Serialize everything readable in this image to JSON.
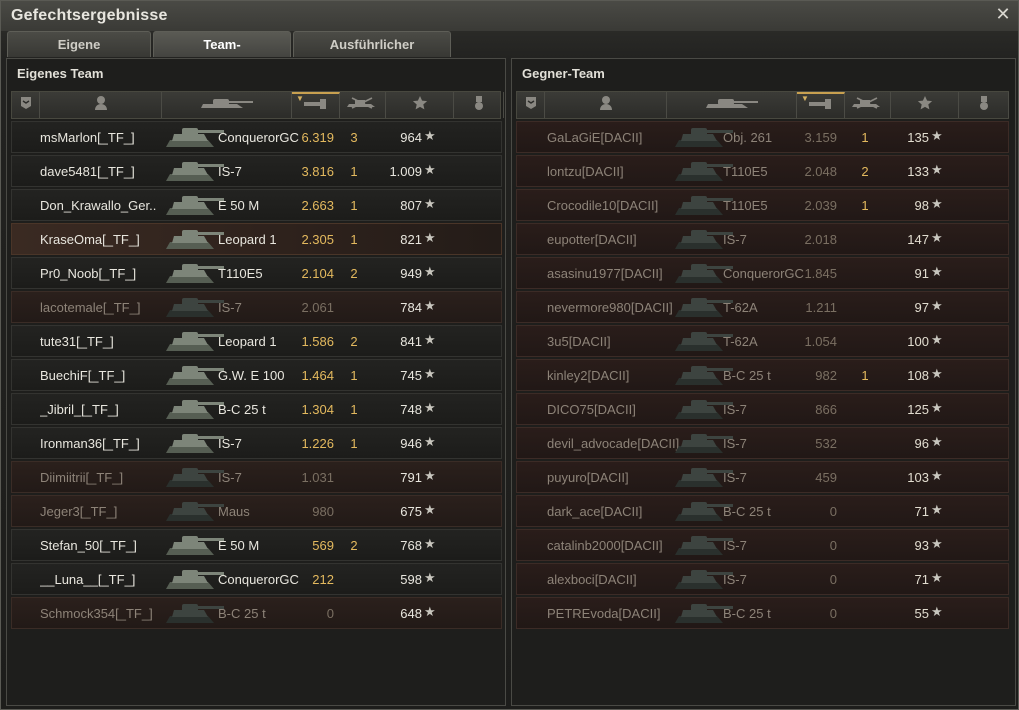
{
  "window": {
    "title": "Gefechtsergebnisse"
  },
  "tabs": [
    {
      "label": "Eigene Auswertung",
      "active": false
    },
    {
      "label": "Team-Auswertung",
      "active": true
    },
    {
      "label": "Ausführlicher Bericht",
      "active": false
    }
  ],
  "colors": {
    "accent": "#e3b95e",
    "sort_indicator": "#c8a050"
  },
  "header_icons": [
    "rank-icon",
    "player-icon",
    "tank-icon",
    "damage-icon",
    "kills-icon",
    "xp-star-icon",
    "medal-icon"
  ],
  "own_team": {
    "title": "Eigenes Team",
    "rows": [
      {
        "name": "msMarlon[_TF_]",
        "tank": "ConquerorGC",
        "damage": "6.319",
        "kills": "3",
        "xp": "964",
        "state": "alive"
      },
      {
        "name": "dave5481[_TF_]",
        "tank": "IS-7",
        "damage": "3.816",
        "kills": "1",
        "xp": "1.009",
        "state": "alive"
      },
      {
        "name": "Don_Krawallo_Ger..",
        "tank": "E 50 M",
        "damage": "2.663",
        "kills": "1",
        "xp": "807",
        "state": "alive"
      },
      {
        "name": "KraseOma[_TF_]",
        "tank": "Leopard 1",
        "damage": "2.305",
        "kills": "1",
        "xp": "821",
        "state": "self"
      },
      {
        "name": "Pr0_Noob[_TF_]",
        "tank": "T110E5",
        "damage": "2.104",
        "kills": "2",
        "xp": "949",
        "state": "alive"
      },
      {
        "name": "lacotemale[_TF_]",
        "tank": "IS-7",
        "damage": "2.061",
        "kills": "",
        "xp": "784",
        "state": "dead"
      },
      {
        "name": "tute31[_TF_]",
        "tank": "Leopard 1",
        "damage": "1.586",
        "kills": "2",
        "xp": "841",
        "state": "alive"
      },
      {
        "name": "BuechiF[_TF_]",
        "tank": "G.W. E 100",
        "damage": "1.464",
        "kills": "1",
        "xp": "745",
        "state": "alive"
      },
      {
        "name": "_Jibril_[_TF_]",
        "tank": "B-C 25 t",
        "damage": "1.304",
        "kills": "1",
        "xp": "748",
        "state": "alive"
      },
      {
        "name": "Ironman36[_TF_]",
        "tank": "IS-7",
        "damage": "1.226",
        "kills": "1",
        "xp": "946",
        "state": "alive"
      },
      {
        "name": "Diimiitrii[_TF_]",
        "tank": "IS-7",
        "damage": "1.031",
        "kills": "",
        "xp": "791",
        "state": "dead"
      },
      {
        "name": "Jeger3[_TF_]",
        "tank": "Maus",
        "damage": "980",
        "kills": "",
        "xp": "675",
        "state": "dead"
      },
      {
        "name": "Stefan_50[_TF_]",
        "tank": "E 50 M",
        "damage": "569",
        "kills": "2",
        "xp": "768",
        "state": "alive"
      },
      {
        "name": "__Luna__[_TF_]",
        "tank": "ConquerorGC",
        "damage": "212",
        "kills": "",
        "xp": "598",
        "state": "alive"
      },
      {
        "name": "Schmock354[_TF_]",
        "tank": "B-C 25 t",
        "damage": "0",
        "kills": "",
        "xp": "648",
        "state": "dead"
      }
    ]
  },
  "enemy_team": {
    "title": "Gegner-Team",
    "rows": [
      {
        "name": "GaLaGiE[DACII]",
        "tank": "Obj. 261",
        "damage": "3.159",
        "kills": "1",
        "xp": "135"
      },
      {
        "name": "lontzu[DACII]",
        "tank": "T110E5",
        "damage": "2.048",
        "kills": "2",
        "xp": "133"
      },
      {
        "name": "Crocodile10[DACII]",
        "tank": "T110E5",
        "damage": "2.039",
        "kills": "1",
        "xp": "98"
      },
      {
        "name": "eupotter[DACII]",
        "tank": "IS-7",
        "damage": "2.018",
        "kills": "",
        "xp": "147"
      },
      {
        "name": "asasinu1977[DACII]",
        "tank": "ConquerorGC",
        "damage": "1.845",
        "kills": "",
        "xp": "91"
      },
      {
        "name": "nevermore980[DACII]",
        "tank": "T-62A",
        "damage": "1.211",
        "kills": "",
        "xp": "97"
      },
      {
        "name": "3u5[DACII]",
        "tank": "T-62A",
        "damage": "1.054",
        "kills": "",
        "xp": "100"
      },
      {
        "name": "kinley2[DACII]",
        "tank": "B-C 25 t",
        "damage": "982",
        "kills": "1",
        "xp": "108"
      },
      {
        "name": "DICO75[DACII]",
        "tank": "IS-7",
        "damage": "866",
        "kills": "",
        "xp": "125"
      },
      {
        "name": "devil_advocade[DACII]",
        "tank": "IS-7",
        "damage": "532",
        "kills": "",
        "xp": "96"
      },
      {
        "name": "puyuro[DACII]",
        "tank": "IS-7",
        "damage": "459",
        "kills": "",
        "xp": "103"
      },
      {
        "name": "dark_ace[DACII]",
        "tank": "B-C 25 t",
        "damage": "0",
        "kills": "",
        "xp": "71"
      },
      {
        "name": "catalinb2000[DACII]",
        "tank": "IS-7",
        "damage": "0",
        "kills": "",
        "xp": "93"
      },
      {
        "name": "alexboci[DACII]",
        "tank": "IS-7",
        "damage": "0",
        "kills": "",
        "xp": "71"
      },
      {
        "name": "PETREvoda[DACII]",
        "tank": "B-C 25 t",
        "damage": "0",
        "kills": "",
        "xp": "55"
      }
    ]
  }
}
